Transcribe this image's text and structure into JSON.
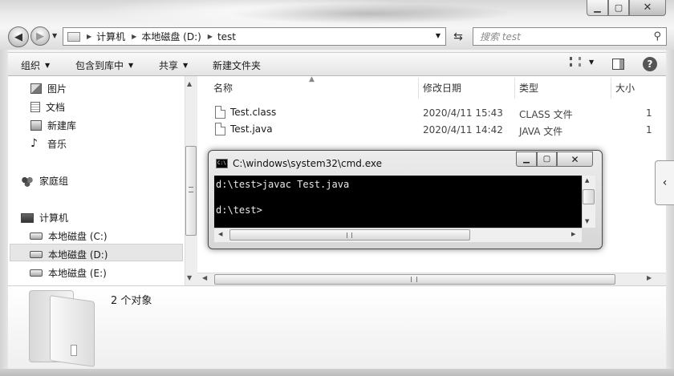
{
  "window": {
    "min_glyph": "▁",
    "max_glyph": "▢",
    "close_glyph": "✕"
  },
  "addressbar": {
    "crumbs": [
      "计算机",
      "本地磁盘 (D:)",
      "test"
    ]
  },
  "search": {
    "placeholder": "搜索 test"
  },
  "toolbar": {
    "organize": "组织",
    "include_in_library": "包含到库中",
    "share": "共享",
    "new_folder": "新建文件夹"
  },
  "nav_pane": {
    "items": [
      {
        "label": "图片",
        "icon": "pictures-icon"
      },
      {
        "label": "文档",
        "icon": "documents-icon"
      },
      {
        "label": "新建库",
        "icon": "library-icon"
      },
      {
        "label": "音乐",
        "icon": "music-icon"
      },
      {
        "label": "家庭组",
        "icon": "homegroup-icon"
      },
      {
        "label": "计算机",
        "icon": "computer-icon"
      },
      {
        "label": "本地磁盘 (C:)",
        "icon": "drive-c-icon"
      },
      {
        "label": "本地磁盘 (D:)",
        "icon": "drive-d-icon",
        "selected": true
      },
      {
        "label": "本地磁盘 (E:)",
        "icon": "drive-e-icon"
      }
    ]
  },
  "file_list": {
    "columns": [
      "名称",
      "修改日期",
      "类型",
      "大小"
    ],
    "rows": [
      {
        "name": "Test.class",
        "date": "2020/4/11 15:43",
        "type": "CLASS 文件",
        "size": "1"
      },
      {
        "name": "Test.java",
        "date": "2020/4/11 14:42",
        "type": "JAVA 文件",
        "size": "1"
      }
    ]
  },
  "details": {
    "object_count": "2 个对象"
  },
  "cmd": {
    "title": "C:\\windows\\system32\\cmd.exe",
    "icon_text": "C:\\",
    "lines": [
      "d:\\test>javac Test.java",
      "",
      "d:\\test>"
    ]
  }
}
